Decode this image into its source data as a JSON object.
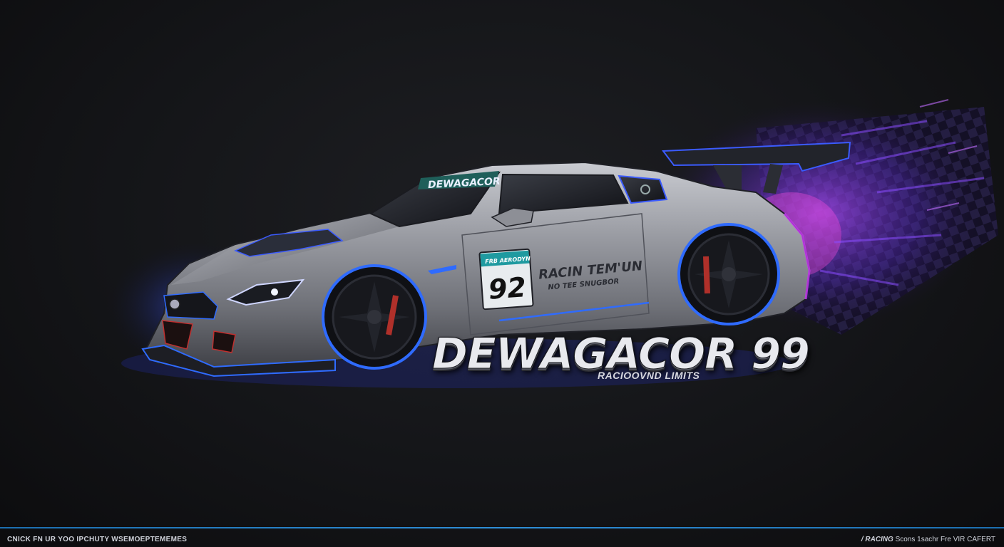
{
  "car": {
    "windshield_banner": "DEWAGACOR",
    "door_text_line1": "RACIN TEM'UN",
    "door_text_line2": "NO TEE SNUGBOR",
    "race_number": "92",
    "plate_top": "FRB AERODYN"
  },
  "brand": {
    "title": "DEWAGACOR 99",
    "tagline": "RACIOOVND LIMITS"
  },
  "footer": {
    "left_text": "CNICK FN UR YOO IPCHUTY WSEMOEPTEMEMES",
    "right_bold": "/ RACING",
    "right_text": "Scons 1sachr Fre VIR CAFERT"
  },
  "colors": {
    "background": "#141518",
    "accent_blue": "#2f8fd8",
    "glow_purple": "#7b3cff",
    "glow_magenta": "#d23cff",
    "car_body": "#8b8d94"
  }
}
